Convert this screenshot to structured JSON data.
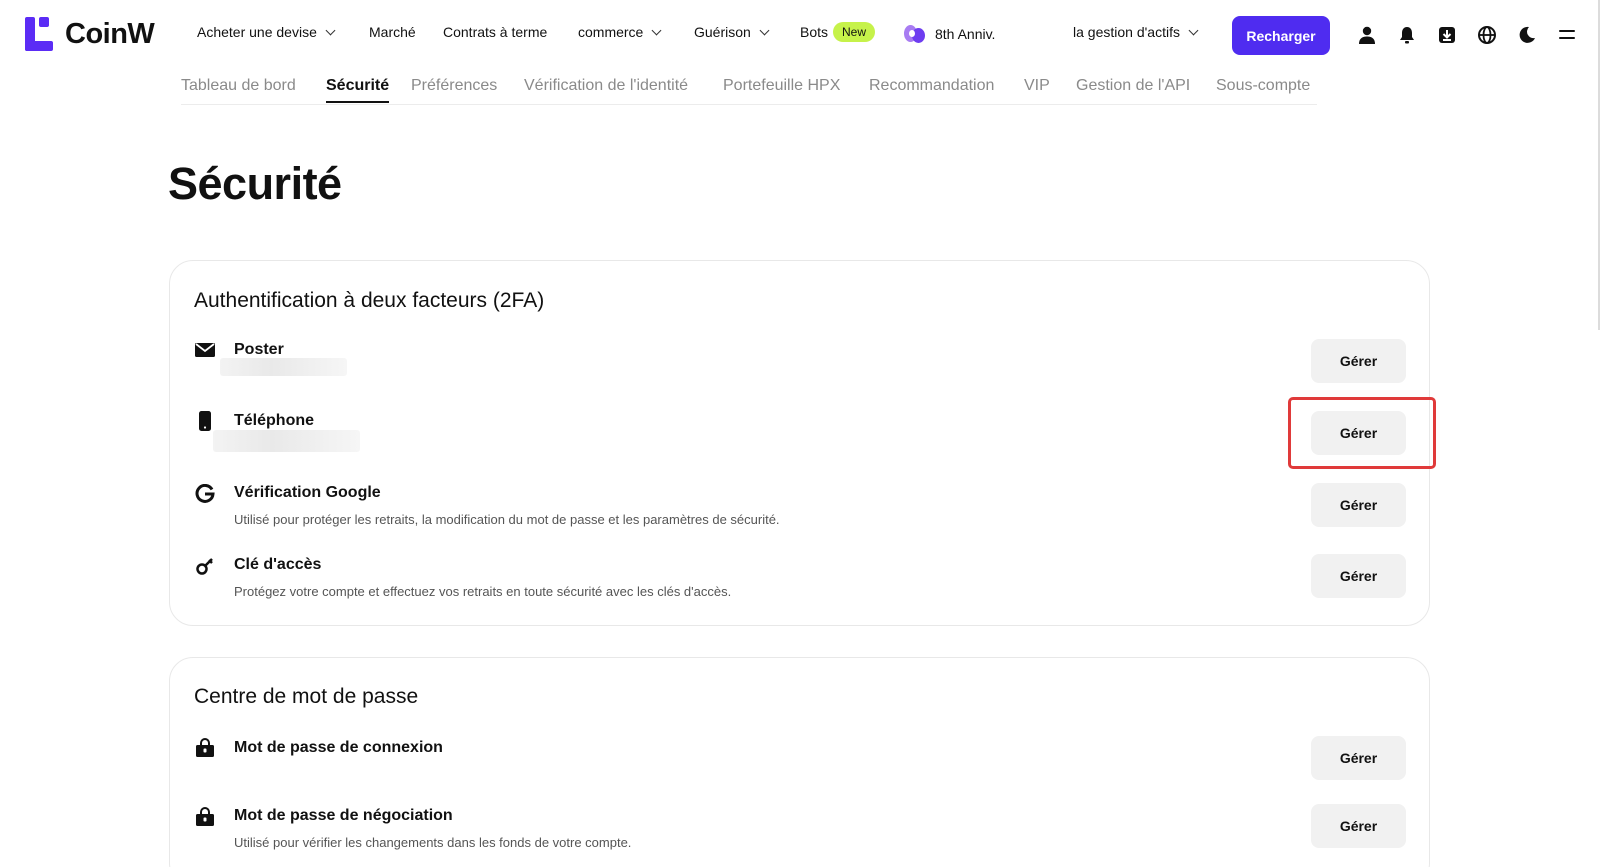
{
  "header": {
    "logo_text": "CoinW",
    "nav": [
      {
        "label": "Acheter une devise",
        "dropdown": true
      },
      {
        "label": "Marché",
        "dropdown": false
      },
      {
        "label": "Contrats à terme",
        "dropdown": false
      },
      {
        "label": "commerce",
        "dropdown": true
      },
      {
        "label": "Guérison",
        "dropdown": true
      },
      {
        "label": "Bots",
        "badge": "New"
      },
      {
        "label": "8th Anniv."
      }
    ],
    "asset_menu": "la gestion d'actifs",
    "recharge_label": "Recharger",
    "icons": [
      "user-icon",
      "bell-icon",
      "download-icon",
      "globe-icon",
      "moon-icon",
      "menu-icon"
    ],
    "brand_color": "#4f2cf0"
  },
  "subnav": {
    "items": [
      "Tableau de bord",
      "Sécurité",
      "Préférences",
      "Vérification de l'identité",
      "Portefeuille HPX",
      "Recommandation",
      "VIP",
      "Gestion de l'API",
      "Sous-compte"
    ],
    "active": "Sécurité"
  },
  "page_title": "Sécurité",
  "twofa": {
    "title": "Authentification à deux facteurs (2FA)",
    "rows": [
      {
        "icon": "mail-icon",
        "label": "Poster",
        "desc": "",
        "button": "Gérer"
      },
      {
        "icon": "phone-icon",
        "label": "Téléphone",
        "desc": "",
        "button": "Gérer"
      },
      {
        "icon": "google-icon",
        "label": "Vérification Google",
        "desc": "Utilisé pour protéger les retraits, la modification du mot de passe et les paramètres de sécurité.",
        "button": "Gérer"
      },
      {
        "icon": "key-icon",
        "label": "Clé d'accès",
        "desc": "Protégez votre compte et effectuez vos retraits en toute sécurité avec les clés d'accès.",
        "button": "Gérer"
      }
    ]
  },
  "password_center": {
    "title": "Centre de mot de passe",
    "rows": [
      {
        "icon": "lock-icon",
        "label": "Mot de passe de connexion",
        "desc": "",
        "button": "Gérer"
      },
      {
        "icon": "lock-icon",
        "label": "Mot de passe de négociation",
        "desc": "Utilisé pour vérifier les changements dans les fonds de votre compte.",
        "button": "Gérer"
      }
    ]
  },
  "highlight_color": "#e03a3a"
}
